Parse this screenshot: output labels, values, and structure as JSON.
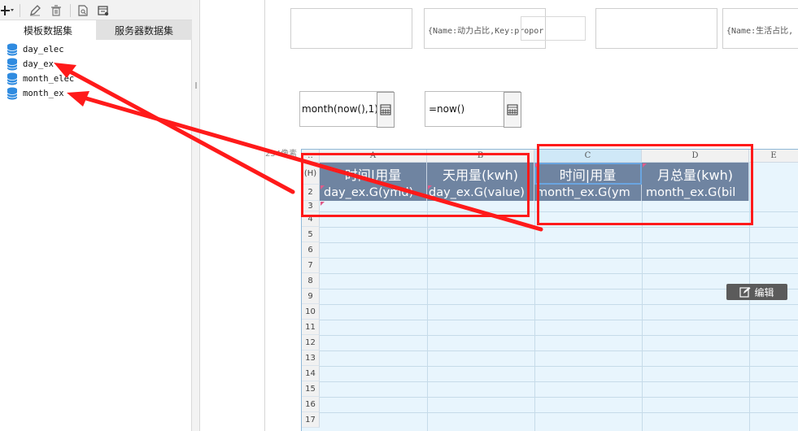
{
  "tabs": {
    "template": "模板数据集",
    "server": "服务器数据集"
  },
  "datasets": [
    "day_elec",
    "day_ex",
    "month_elec",
    "month_ex"
  ],
  "widgets": {
    "formula1": "{Name:动力占比,Key:propor",
    "formula2": "{Name:生活占比,",
    "date1": "month(now(),1)",
    "date2": "=now()",
    "px_label": "254像素"
  },
  "sheet": {
    "columns": [
      "A",
      "B",
      "C",
      "D",
      "E"
    ],
    "rows": [
      "(H)",
      "2",
      "3",
      "4",
      "5",
      "6",
      "7",
      "8",
      "9",
      "10",
      "11",
      "12",
      "13",
      "14",
      "15",
      "16",
      "17"
    ],
    "headers": [
      "时间|用量",
      "天用量(kwh)",
      "时间|用量",
      "月总量(kwh)"
    ],
    "data": [
      "day_ex.G(ymd)",
      "day_ex.G(value)",
      "month_ex.G(ym",
      "month_ex.G(bil"
    ]
  },
  "edit_button": "编辑",
  "colors": {
    "annotation": "#ff1a1a",
    "header_fill": "#6f84a1",
    "grid_bg": "#e8f5fd"
  }
}
